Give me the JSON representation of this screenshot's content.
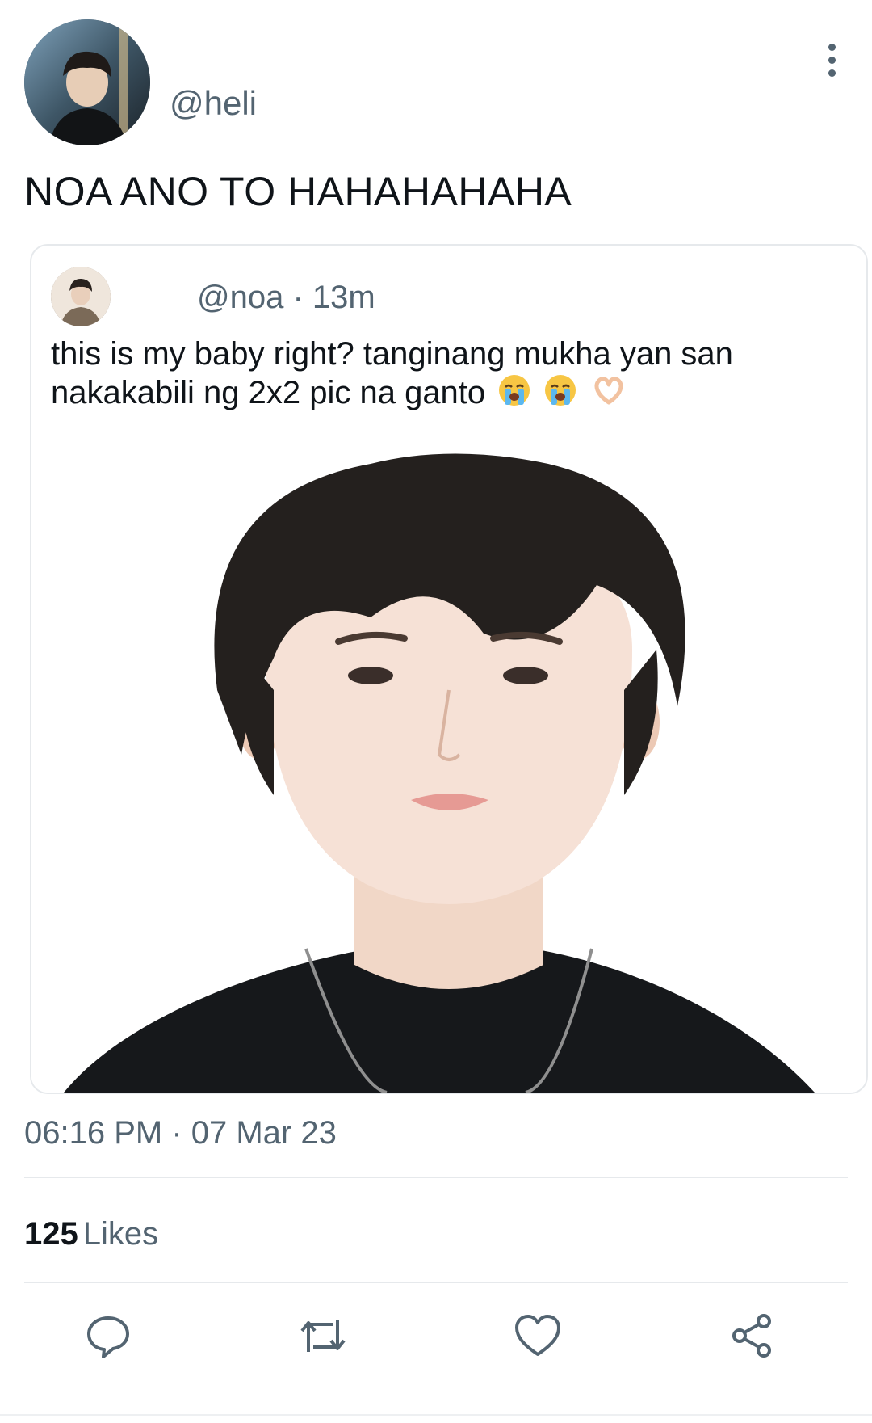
{
  "tweet": {
    "handle": "@heli",
    "text": "NOA ANO TO HAHAHAHAHA",
    "timestamp": "06:16 PM · 07 Mar 23",
    "likes_count": "125",
    "likes_label": "Likes"
  },
  "quoted_tweet": {
    "handle": "@noa",
    "separator": "·",
    "time_ago": "13m",
    "text": "this is my baby right? tanginang mukha yan san nakakabili ng 2x2 pic na ganto",
    "emojis": [
      "loudly-crying-face",
      "loudly-crying-face",
      "heart-hands"
    ]
  },
  "icons": {
    "more": "more-vertical-icon",
    "reply": "reply-icon",
    "retweet": "retweet-icon",
    "like": "heart-icon",
    "share": "share-icon"
  },
  "colors": {
    "text": "#0f1419",
    "secondary": "#536471",
    "divider": "#e6e9ec"
  }
}
